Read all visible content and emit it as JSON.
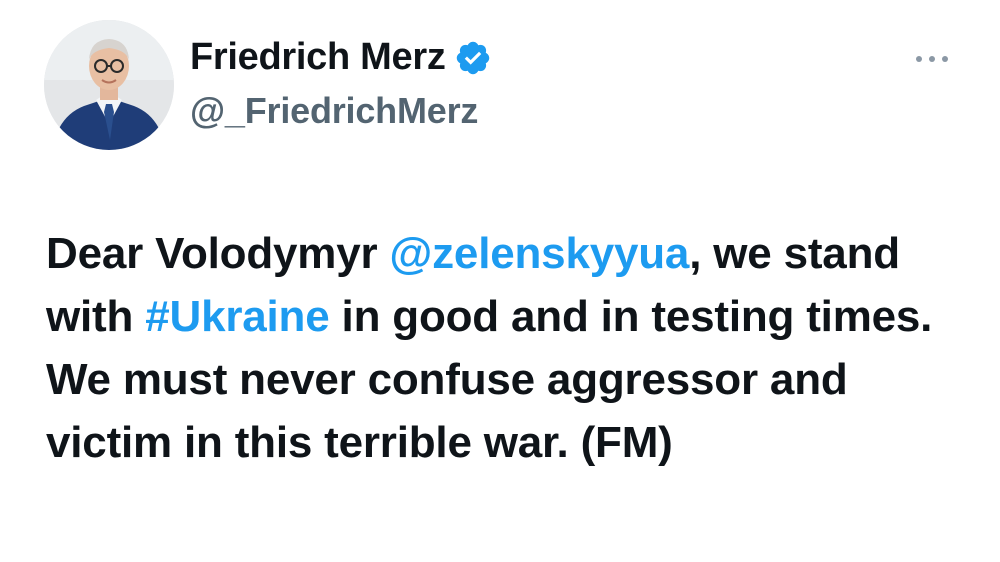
{
  "author": {
    "display_name": "Friedrich Merz",
    "handle": "@_FriedrichMerz",
    "verified": true,
    "verified_icon": "verified-badge-icon",
    "verified_color": "#1d9bf0"
  },
  "menu": {
    "icon": "more-horizontal-icon"
  },
  "tweet": {
    "text_parts": {
      "t1": "Dear Volodymyr ",
      "mention": "@zelenskyyua",
      "t2": ", we stand with ",
      "hashtag": "#Ukraine",
      "t3": " in good and in testing times. We must never confuse aggressor and victim in this terrible war. (FM)"
    },
    "link_color": "#1d9bf0"
  }
}
